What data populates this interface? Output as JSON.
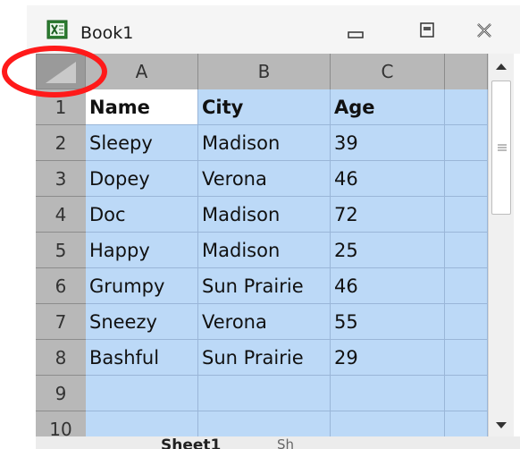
{
  "window": {
    "title": "Book1",
    "controls": [
      "minimize",
      "maximize",
      "close"
    ]
  },
  "grid": {
    "columns": [
      "A",
      "B",
      "C"
    ],
    "rows": [
      "1",
      "2",
      "3",
      "4",
      "5",
      "6",
      "7",
      "8",
      "9",
      "10"
    ],
    "cells": [
      [
        "Name",
        "City",
        "Age"
      ],
      [
        "Sleepy",
        "Madison",
        "39"
      ],
      [
        "Dopey",
        "Verona",
        "46"
      ],
      [
        "Doc",
        "Madison",
        "72"
      ],
      [
        "Happy",
        "Madison",
        "25"
      ],
      [
        "Grumpy",
        "Sun Prairie",
        "46"
      ],
      [
        "Sneezy",
        "Verona",
        "55"
      ],
      [
        "Bashful",
        "Sun Prairie",
        "29"
      ],
      [
        "",
        "",
        ""
      ],
      [
        "",
        "",
        ""
      ]
    ],
    "selection": "all",
    "active_cell": "A1",
    "colors": {
      "selection": "#bcd9f7",
      "header": "#b8b8b8",
      "annotation": "#ff1a1a"
    }
  },
  "sheet_tabs": {
    "active": "Sheet1",
    "next_partial": "Sh"
  }
}
